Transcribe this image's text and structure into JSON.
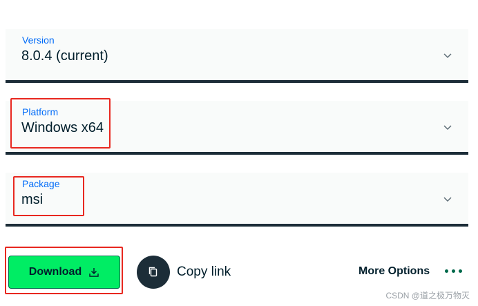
{
  "version": {
    "label": "Version",
    "value": "8.0.4 (current)"
  },
  "platform": {
    "label": "Platform",
    "value": "Windows x64"
  },
  "package": {
    "label": "Package",
    "value": "msi"
  },
  "actions": {
    "download_label": "Download",
    "copy_link_label": "Copy link",
    "more_options_label": "More Options"
  },
  "icons": [
    "chevron-down-icon",
    "download-icon",
    "copy-icon",
    "more-dots-icon"
  ],
  "colors": {
    "label_blue": "#016bf8",
    "download_green": "#00ed64",
    "dark": "#001e2b",
    "highlight_red": "#e8271f"
  },
  "watermark": "CSDN @道之极万物灭"
}
